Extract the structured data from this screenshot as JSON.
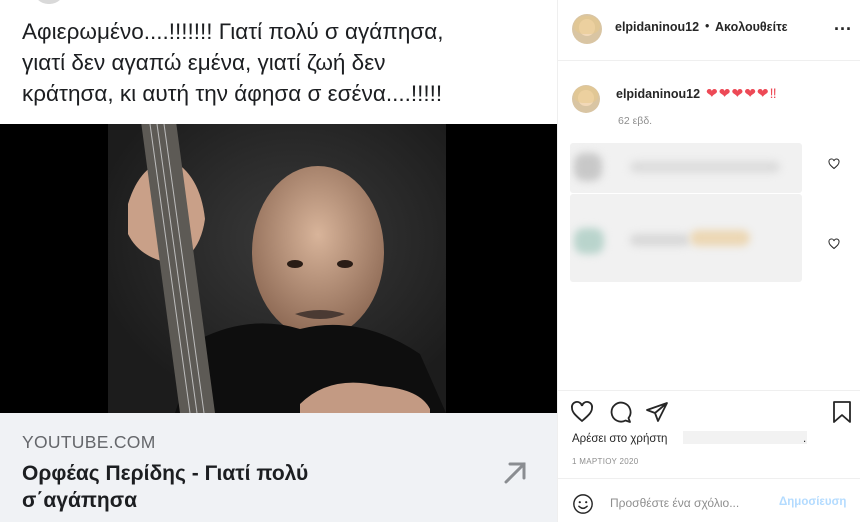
{
  "post": {
    "quote_lines": [
      "Αφιερωμένο....!!!!!!! Γιατί πολύ σ αγάπησα,",
      "γιατί δεν αγαπώ εμένα, γιατί ζωή δεν",
      "κράτησα, κι αυτή την άφησα σ εσένα....!!!!!"
    ],
    "link": {
      "domain": "YOUTUBE.COM",
      "title_lines": [
        "Ορφέας Περίδης - Γιατί πολύ",
        "σ΄αγάπησα"
      ]
    }
  },
  "header": {
    "username": "elpidaninou12",
    "separator": "•",
    "follow_label": "Ακολουθείτε",
    "more_label": "..."
  },
  "caption": {
    "username": "elpidaninou12",
    "text": "❤❤❤❤❤‼",
    "time": "62 εβδ."
  },
  "footer": {
    "likes_prefix": "Αρέσει στο χρήστη",
    "likes_suffix": ".",
    "date": "1 ΜΑΡΤΙΟΥ 2020",
    "comment_placeholder": "Προσθέστε ένα σχόλιο...",
    "publish_label": "Δημοσίευση"
  },
  "icons": {
    "like": "heart-icon",
    "comment": "comment-icon",
    "share": "paper-plane-icon",
    "save": "bookmark-icon",
    "emoji": "smiley-icon",
    "link_arrow": "arrow-up-right-icon"
  },
  "colors": {
    "caption_hearts": "#ed4956",
    "publish_disabled": "#b3dbff",
    "link_card_bg": "#f0f2f5"
  }
}
